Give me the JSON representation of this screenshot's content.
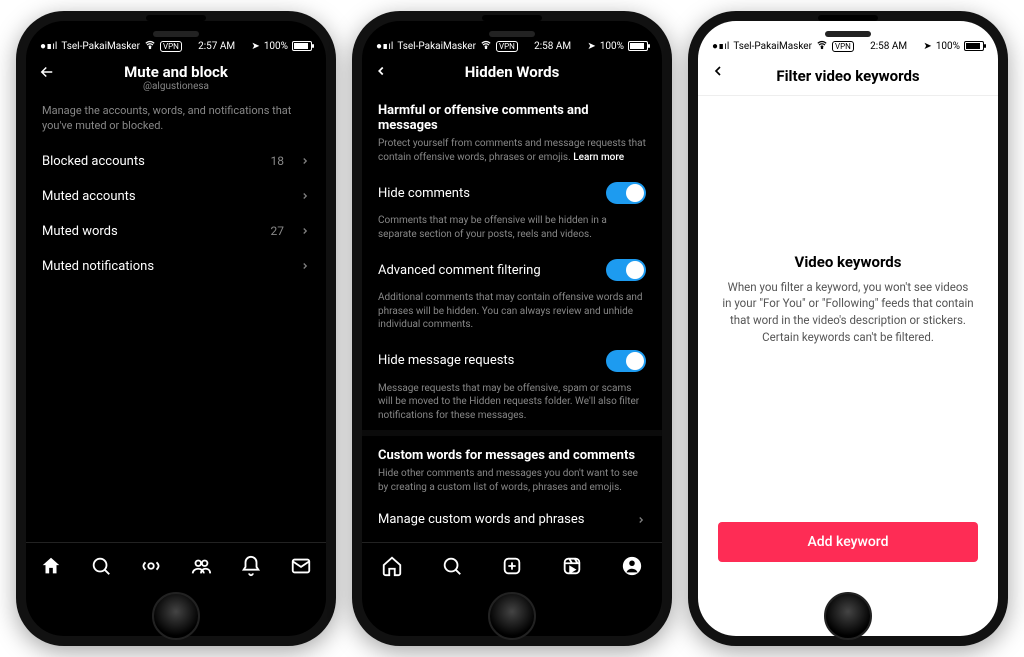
{
  "statusbar": {
    "carrier": "Tsel-PakaiMasker",
    "vpn_badge": "VPN",
    "time": "2:58 AM",
    "time_p1": "2:57 AM",
    "battery": "100%"
  },
  "phone1": {
    "title": "Mute and block",
    "subtitle": "@algustionesa",
    "description": "Manage the accounts, words, and notifications that you've muted or blocked.",
    "rows": [
      {
        "label": "Blocked accounts",
        "count": "18"
      },
      {
        "label": "Muted accounts",
        "count": ""
      },
      {
        "label": "Muted words",
        "count": "27"
      },
      {
        "label": "Muted notifications",
        "count": ""
      }
    ]
  },
  "phone2": {
    "title": "Hidden Words",
    "sec1_title": "Harmful or offensive comments and messages",
    "sec1_desc": "Protect yourself from comments and message requests that contain offensive words, phrases or emojis.",
    "learn_more": "Learn more",
    "toggle1_label": "Hide comments",
    "toggle1_desc": "Comments that may be offensive will be hidden in a separate section of your posts, reels and videos.",
    "toggle2_label": "Advanced comment filtering",
    "toggle2_desc": "Additional comments that may contain offensive words and phrases will be hidden. You can always review and unhide individual comments.",
    "toggle3_label": "Hide message requests",
    "toggle3_desc": "Message requests that may be offensive, spam or scams will be moved to the Hidden requests folder. We'll also filter notifications for these messages.",
    "sec2_title": "Custom words for messages and comments",
    "sec2_desc": "Hide other comments and messages you don't want to see by creating a custom list of words, phrases and emojis.",
    "manage_row": "Manage custom words and phrases",
    "toggle4_label": "Hide comments"
  },
  "phone3": {
    "title": "Filter video keywords",
    "heading": "Video keywords",
    "body": "When you filter a keyword, you won't see videos in your \"For You\" or \"Following\" feeds that contain that word in the video's description or stickers. Certain keywords can't be filtered.",
    "button": "Add keyword"
  }
}
